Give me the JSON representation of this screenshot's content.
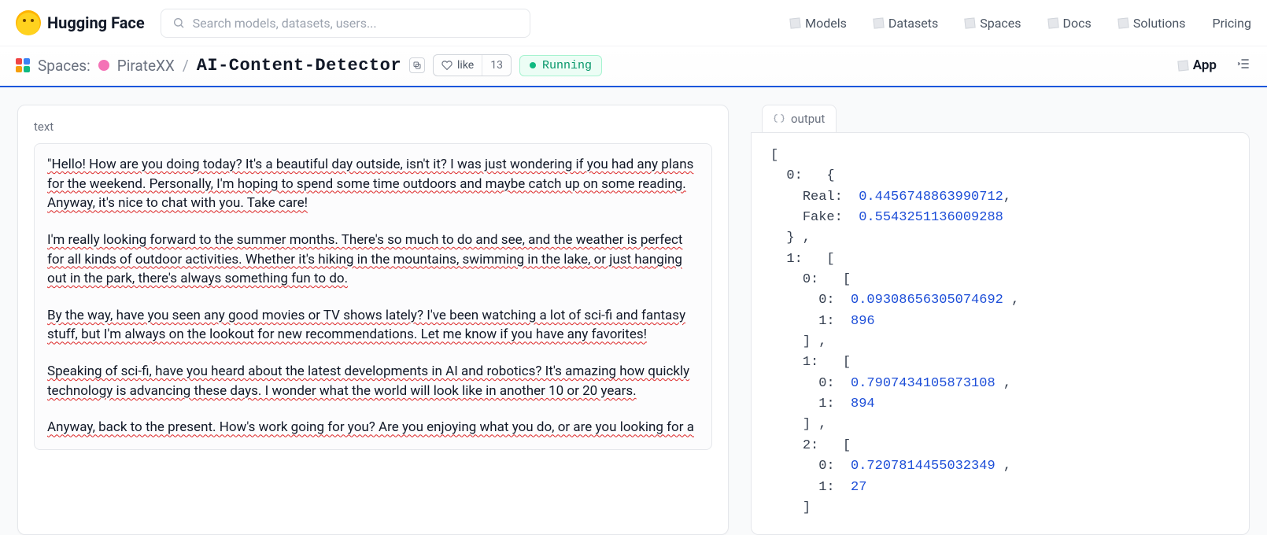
{
  "brand": "Hugging Face",
  "search_placeholder": "Search models, datasets, users...",
  "nav": {
    "models": "Models",
    "datasets": "Datasets",
    "spaces": "Spaces",
    "docs": "Docs",
    "solutions": "Solutions",
    "pricing": "Pricing"
  },
  "sub": {
    "spaces_label": "Spaces:",
    "owner": "PirateXX",
    "name": "AI-Content-Detector",
    "like_label": "like",
    "like_count": "13",
    "status": "Running",
    "app": "App"
  },
  "input": {
    "label": "text",
    "p1": "\"Hello! How are you doing today? It's a beautiful day outside, isn't it? I was just wondering if you had any plans for the weekend. Personally, I'm hoping to spend some time outdoors and maybe catch up on some reading. Anyway, it's nice to chat with you. Take care!",
    "p2": "I'm really looking forward to the summer months. There's so much to do and see, and the weather is perfect for all kinds of outdoor activities. Whether it's hiking in the mountains, swimming in the lake, or just hanging out in the park, there's always something fun to do.",
    "p3": "By the way, have you seen any good movies or TV shows lately? I've been watching a lot of sci-fi and fantasy stuff, but I'm always on the lookout for new recommendations. Let me know if you have any favorites!",
    "p4": "Speaking of sci-fi, have you heard about the latest developments in AI and robotics? It's amazing how quickly technology is advancing these days. I wonder what the world will look like in another 10 or 20 years.",
    "p5": "Anyway, back to the present. How's work going for you? Are you enjoying what you do, or are you looking for a"
  },
  "output": {
    "tab": "output",
    "real_key": "Real",
    "fake_key": "Fake",
    "real": "0.4456748863990712",
    "fake": "0.5543251136009288",
    "seg0_score": "0.09308656305074692",
    "seg0_len": "896",
    "seg1_score": "0.7907434105873108",
    "seg1_len": "894",
    "seg2_score": "0.7207814455032349",
    "seg2_len": "27"
  }
}
